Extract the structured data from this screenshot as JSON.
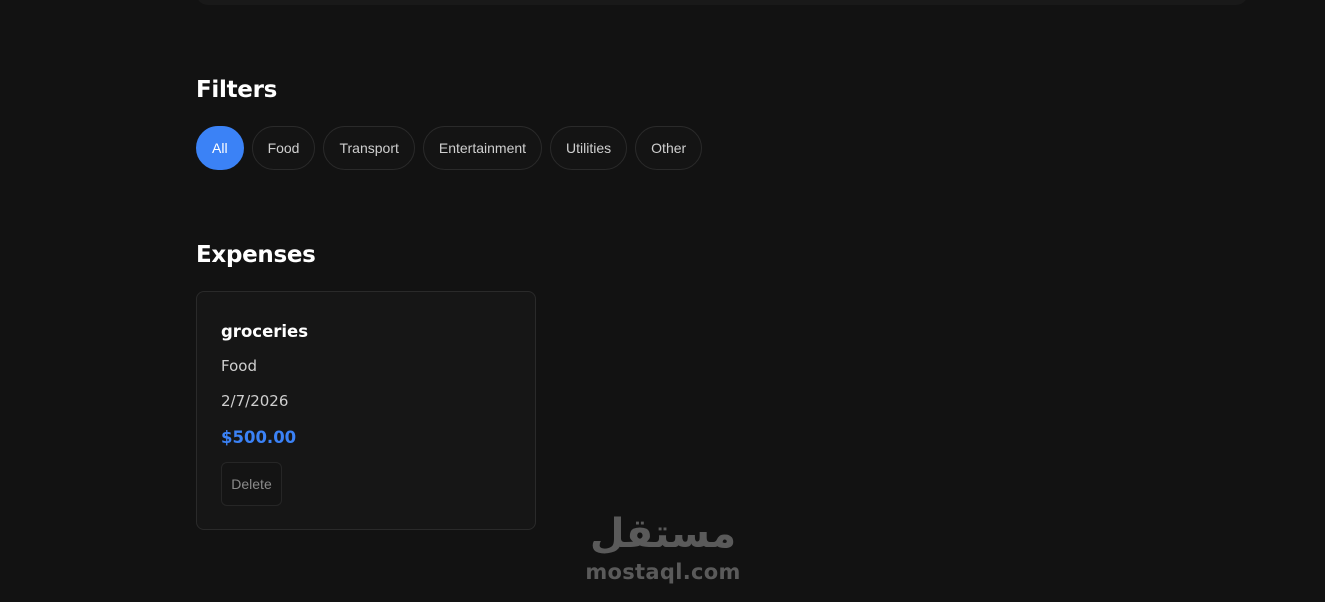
{
  "filters": {
    "title": "Filters",
    "items": [
      {
        "label": "All",
        "active": true
      },
      {
        "label": "Food",
        "active": false
      },
      {
        "label": "Transport",
        "active": false
      },
      {
        "label": "Entertainment",
        "active": false
      },
      {
        "label": "Utilities",
        "active": false
      },
      {
        "label": "Other",
        "active": false
      }
    ]
  },
  "expenses": {
    "title": "Expenses",
    "items": [
      {
        "name": "groceries",
        "category": "Food",
        "date": "2/7/2026",
        "amount": "$500.00",
        "delete_label": "Delete"
      }
    ]
  },
  "watermark": {
    "arabic": "مستقل",
    "latin": "mostaql.com"
  },
  "colors": {
    "background": "#121212",
    "accent": "#3b82f6",
    "card": "#161616"
  }
}
